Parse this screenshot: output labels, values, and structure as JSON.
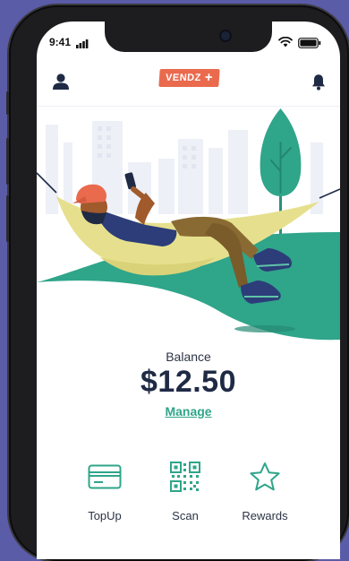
{
  "status": {
    "time": "9:41"
  },
  "header": {
    "logo_text": "VENDZ",
    "logo_symbol": "+"
  },
  "icons": {
    "profile": "person-icon",
    "notifications": "bell-icon",
    "topup": "credit-card-icon",
    "scan": "qr-code-icon",
    "rewards": "star-icon"
  },
  "balance": {
    "label": "Balance",
    "amount": "$12.50",
    "manage_label": "Manage"
  },
  "actions": [
    {
      "label": "TopUp"
    },
    {
      "label": "Scan"
    },
    {
      "label": "Rewards"
    }
  ],
  "colors": {
    "brand": "#ea6a4e",
    "accent": "#2fa58a",
    "text": "#1f2a45",
    "hill": "#2fa58a"
  }
}
